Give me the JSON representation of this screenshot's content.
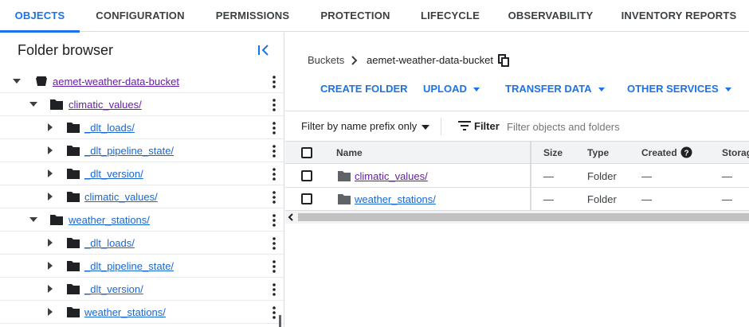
{
  "tabs": [
    {
      "label": "OBJECTS",
      "active": true
    },
    {
      "label": "CONFIGURATION"
    },
    {
      "label": "PERMISSIONS"
    },
    {
      "label": "PROTECTION"
    },
    {
      "label": "LIFECYCLE"
    },
    {
      "label": "OBSERVABILITY"
    },
    {
      "label": "INVENTORY REPORTS"
    }
  ],
  "sidebar": {
    "title": "Folder browser",
    "items": [
      {
        "label": "aemet-weather-data-bucket",
        "type": "bucket",
        "expanded": true
      },
      {
        "label": "climatic_values/",
        "expanded": true
      },
      {
        "label": "_dlt_loads/"
      },
      {
        "label": "_dlt_pipeline_state/"
      },
      {
        "label": "_dlt_version/"
      },
      {
        "label": "climatic_values/"
      },
      {
        "label": "weather_stations/",
        "expanded": true
      },
      {
        "label": "_dlt_loads/"
      },
      {
        "label": "_dlt_pipeline_state/"
      },
      {
        "label": "_dlt_version/"
      },
      {
        "label": "weather_stations/"
      }
    ]
  },
  "breadcrumb": {
    "root": "Buckets",
    "current": "aemet-weather-data-bucket"
  },
  "actions": [
    "CREATE FOLDER",
    "UPLOAD",
    "TRANSFER DATA",
    "OTHER SERVICES"
  ],
  "filter": {
    "prefix_label": "Filter by name prefix only",
    "filter_label": "Filter",
    "placeholder": "Filter objects and folders"
  },
  "table": {
    "columns": [
      "Name",
      "Size",
      "Type",
      "Created",
      "Storag"
    ],
    "rows": [
      {
        "name": "climatic_values/",
        "size": "—",
        "type": "Folder",
        "created": "—",
        "storage": "—"
      },
      {
        "name": "weather_stations/",
        "size": "—",
        "type": "Folder",
        "created": "—",
        "storage": "—"
      }
    ]
  },
  "colors": {
    "accent": "#1a73e8",
    "visited_link": "#681da8",
    "link": "#1967d2"
  }
}
